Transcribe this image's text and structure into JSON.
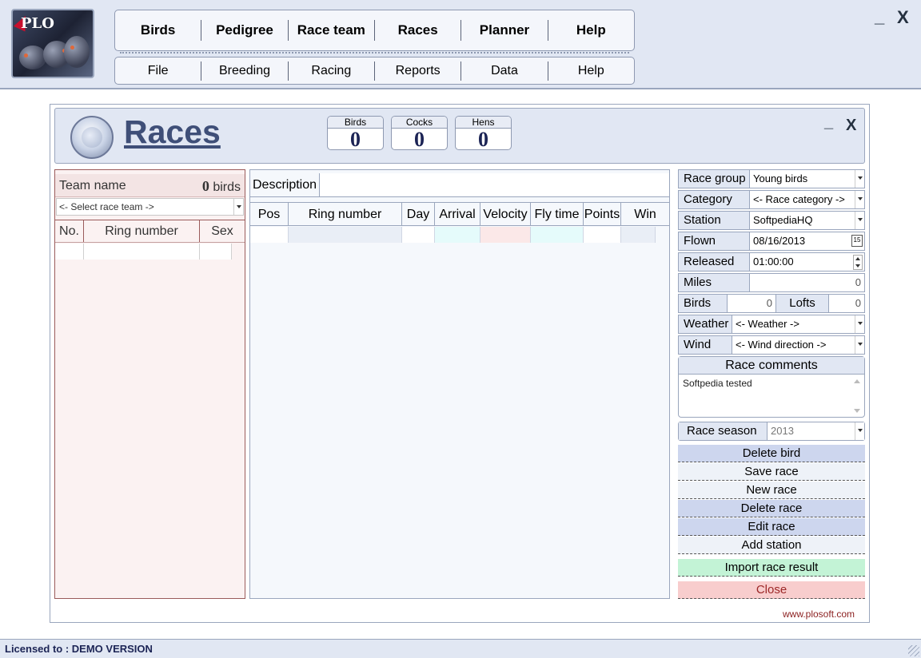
{
  "app": {
    "logo_text": "PLO",
    "main_menu": [
      "Birds",
      "Pedigree",
      "Race team",
      "Races",
      "Planner",
      "Help"
    ],
    "sub_menu": [
      "File",
      "Breeding",
      "Racing",
      "Reports",
      "Data",
      "Help"
    ],
    "minimize_glyph": "_",
    "close_glyph": "X"
  },
  "window": {
    "title": "Races",
    "counters": [
      {
        "label": "Birds",
        "value": "0"
      },
      {
        "label": "Cocks",
        "value": "0"
      },
      {
        "label": "Hens",
        "value": "0"
      }
    ],
    "minimize_glyph": "_",
    "close_glyph": "X"
  },
  "team": {
    "name_label": "Team name",
    "bird_count": "0",
    "bird_count_suffix": "birds",
    "select_placeholder": "<- Select race team ->",
    "columns": [
      "No.",
      "Ring number",
      "Sex"
    ]
  },
  "grid": {
    "description_label": "Description",
    "description_value": "",
    "columns": [
      "Pos",
      "Ring number",
      "Day",
      "Arrival",
      "Velocity",
      "Fly time",
      "Points",
      "Win"
    ]
  },
  "form": {
    "race_group": {
      "label": "Race group",
      "value": "Young birds"
    },
    "category": {
      "label": "Category",
      "value": "<- Race category ->"
    },
    "station": {
      "label": "Station",
      "value": "SoftpediaHQ"
    },
    "flown": {
      "label": "Flown",
      "value": "08/16/2013",
      "calendar_glyph": "15"
    },
    "released": {
      "label": "Released",
      "value": "01:00:00"
    },
    "miles": {
      "label": "Miles",
      "value": "0"
    },
    "birds": {
      "label": "Birds",
      "value": "0"
    },
    "lofts": {
      "label": "Lofts",
      "value": "0"
    },
    "weather": {
      "label": "Weather",
      "value": "<- Weather ->"
    },
    "wind": {
      "label": "Wind",
      "value": "<- Wind direction ->"
    },
    "comments_label": "Race comments",
    "comments_value": "Softpedia tested",
    "season": {
      "label": "Race season",
      "value": "2013"
    }
  },
  "actions": {
    "delete_bird": "Delete bird",
    "save_race": "Save race",
    "new_race": "New race",
    "delete_race": "Delete race",
    "edit_race": "Edit race",
    "add_station": "Add station",
    "import_result": "Import race result",
    "close": "Close"
  },
  "footer": {
    "website": "www.plosoft.com",
    "license": "Licensed to : DEMO VERSION"
  },
  "colors": {
    "accent": "#3f4f78",
    "panel": "#e1e7f3",
    "team_panel": "#fbf2f2",
    "import": "#c3f3d6",
    "close": "#f8cdcd"
  }
}
